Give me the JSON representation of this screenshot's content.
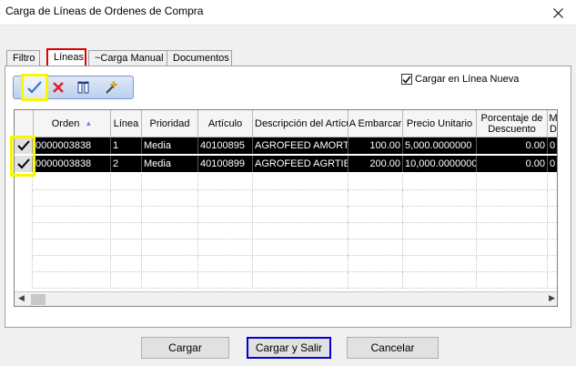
{
  "window": {
    "title": "Carga de Líneas de Ordenes de Compra"
  },
  "tabs": [
    {
      "label": "Filtro"
    },
    {
      "label": "Líneas"
    },
    {
      "label": "~Carga Manual"
    },
    {
      "label": "Documentos"
    }
  ],
  "toolbar": {
    "icons": [
      "check-icon",
      "delete-icon",
      "columns-icon",
      "magic-wand-icon"
    ]
  },
  "options": {
    "load_new_line_label": "Cargar en Línea Nueva",
    "load_new_line_checked": true
  },
  "grid": {
    "columns": [
      "Orden",
      "Línea",
      "Prioridad",
      "Artículo",
      "Descripción del Artículo",
      "A Embarcar",
      "Precio Unitario",
      "Porcentaje de Descuento",
      "M D"
    ],
    "rows": [
      {
        "orden": "0000003838",
        "linea": "1",
        "prioridad": "Media",
        "articulo": "40100895",
        "descripcion": "AGROFEED AMORTIGUA",
        "a_embarcar": "100.00",
        "precio": "5,000.0000000",
        "descuento": "0.00",
        "extra": "0"
      },
      {
        "orden": "0000003838",
        "linea": "2",
        "prioridad": "Media",
        "articulo": "40100899",
        "descripcion": "AGROFEED AGRTIB",
        "a_embarcar": "200.00",
        "precio": "10,000.0000000",
        "descuento": "0.00",
        "extra": "0"
      }
    ]
  },
  "buttons": {
    "load": "Cargar",
    "load_exit": "Cargar y Salir",
    "cancel": "Cancelar"
  },
  "colors": {
    "tab_highlight": "#e00000",
    "toolbar_highlight": "#f7f700",
    "primary_button_border": "#0000d0"
  }
}
